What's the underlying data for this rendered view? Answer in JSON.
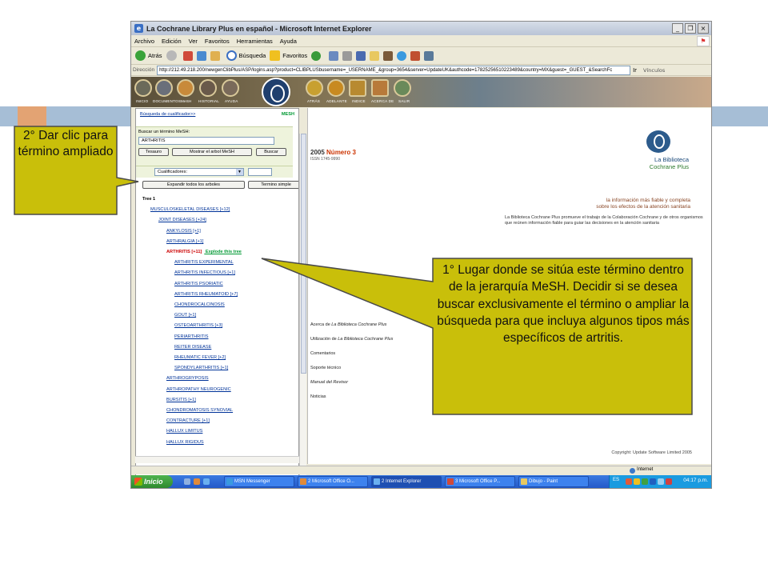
{
  "window": {
    "title": "La Cochrane Library Plus en español - Microsoft Internet Explorer",
    "controls": [
      "_",
      "❐",
      "×"
    ]
  },
  "menubar": [
    "Archivo",
    "Edición",
    "Ver",
    "Favoritos",
    "Herramientas",
    "Ayuda"
  ],
  "toolbar": {
    "back": "Atrás",
    "search": "Búsqueda",
    "favorites": "Favoritos"
  },
  "addressbar": {
    "label": "Dirección",
    "url": "http://212.49.218.200/newgenClibPlus/ASP/logins.asp?product=CLIBPLUSbusername=_USERNAME_&group=3654&server=UpdateUK&authcode=17825256510223489&country=MX&guest=_GUEST_&SearchFc",
    "go": "Ir",
    "links": "Vínculos"
  },
  "cochrane_nav": {
    "left_items": [
      "INICIO",
      "DOCUMENTOS",
      "MeSH",
      "HISTORIAL",
      "AYUDA"
    ],
    "right_items": [
      "ATRÁS",
      "ADELANTE",
      "INDICE",
      "ACERCA DE",
      "SALIR"
    ]
  },
  "left_panel": {
    "qualifier_link": "Búsqueda de cualificador>>",
    "mesh_tag": "MESH",
    "search_caption": "Buscar un término MeSH:",
    "search_value": "ARTHRITIS",
    "btn_thesaurus": "Tesauro",
    "btn_show_tree": "Mostrar el arbol MeSH",
    "btn_search": "Buscar",
    "qualifiers_label": "Cualificadores:",
    "btn_expand_all": "Expandir todos los arboles",
    "btn_simple_term": "Termino simple",
    "tree": [
      {
        "text": "Tree 1",
        "style": "blk"
      },
      {
        "text": "MUSCULOSKELETAL DISEASES [+12]",
        "style": "blue"
      },
      {
        "text": "JOINT DISEASES [+24]",
        "style": "blue"
      },
      {
        "text": "ANKYLOSIS [+1]",
        "style": "blue"
      },
      {
        "text": "ARTHRALGIA [+1]",
        "style": "blue"
      },
      {
        "text": "ARTHRITIS [+11]",
        "style": "red",
        "extra": "Explode this tree"
      },
      {
        "text": "ARTHRITIS EXPERIMENTAL",
        "style": "blue"
      },
      {
        "text": "ARTHRITIS INFECTIOUS [+1]",
        "style": "blue"
      },
      {
        "text": "ARTHRITIS PSORIATIC",
        "style": "blue"
      },
      {
        "text": "ARTHRITIS RHEUMATOID [+7]",
        "style": "blue"
      },
      {
        "text": "CHONDROCALCINOSIS",
        "style": "blue"
      },
      {
        "text": "GOUT [+1]",
        "style": "blue"
      },
      {
        "text": "OSTEOARTHRITIS [+3]",
        "style": "blue"
      },
      {
        "text": "PERIARTHRITIS",
        "style": "blue"
      },
      {
        "text": "REITER DISEASE",
        "style": "blue"
      },
      {
        "text": "RHEUMATIC FEVER [+2]",
        "style": "blue"
      },
      {
        "text": "SPONDYLARTHRITIS [+1]",
        "style": "blue"
      },
      {
        "text": "ARTHROGRYPOSIS",
        "style": "blue"
      },
      {
        "text": "ARTHROPATHY NEUROGENIC",
        "style": "blue"
      },
      {
        "text": "BURSITIS [+1]",
        "style": "blue"
      },
      {
        "text": "CHONDROMATOSIS SYNOVIAL",
        "style": "blue"
      },
      {
        "text": "CONTRACTURE [+1]",
        "style": "blue"
      },
      {
        "text": "HALLUX LIMITUS",
        "style": "blue"
      },
      {
        "text": "HALLUX RIGIDUS",
        "style": "blue"
      }
    ]
  },
  "right_panel": {
    "year": "2005",
    "issue": "Número 3",
    "issn": "ISSN 1745-9990",
    "brand_line1": "La Biblioteca",
    "brand_line2": "Cochrane Plus",
    "tagline1": "la información más fiable y completa",
    "tagline2": "sobre los efectos de la atención sanitaria",
    "description": "La Biblioteca Cochrane Plus promueve el trabajo de la Colaboración Cochrane y de otros organismos que reúnen información fiable para guiar las decisiones en la atención sanitaria",
    "links": [
      {
        "pre": "Acerca de ",
        "em": "La Biblioteca Cochrane Plus"
      },
      {
        "pre": "Utilización de ",
        "em": "La Biblioteca Cochrane Plus"
      },
      {
        "pre": "Comentarios",
        "em": ""
      },
      {
        "pre": "Soporte técnico",
        "em": ""
      },
      {
        "pre": "",
        "em": "Manual del Revisor"
      },
      {
        "pre": "Noticias",
        "em": ""
      }
    ],
    "copyright": "Copyright: Update Software Limited 2005"
  },
  "statusbar": {
    "zone": "Internet"
  },
  "taskbar": {
    "start": "Inicio",
    "tasks": [
      {
        "label": "MSN Messenger",
        "active": false
      },
      {
        "label": "2 Microsoft Office O...",
        "active": false
      },
      {
        "label": "2 Internet Explorer",
        "active": true
      },
      {
        "label": "3 Microsoft Office P...",
        "active": false
      },
      {
        "label": "Dibujo - Paint",
        "active": false
      }
    ],
    "lang": "ES",
    "clock": "04:17 p.m."
  },
  "callouts": {
    "c1": "2° Dar clic para término ampliado",
    "c2": "1° Lugar donde se sitúa este término dentro de la jerarquía MeSH. Decidir si se desea buscar exclusivamente el término o ampliar la búsqueda para que incluya algunos tipos más específicos de artritis."
  },
  "colors": {
    "slide_accent": "#a6bed6",
    "slide_orange": "#e0a070",
    "callout_fill": "#c9bf0a",
    "callout_stroke": "#4a4a4a"
  }
}
